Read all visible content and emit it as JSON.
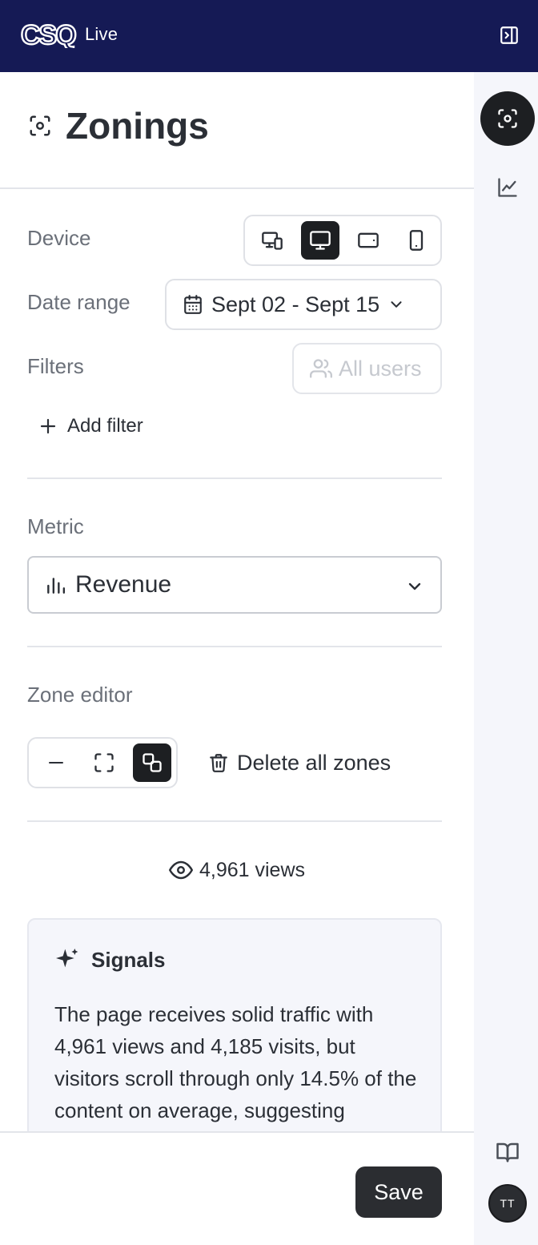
{
  "header": {
    "logo_text": "CSQ",
    "product": "Live"
  },
  "panel": {
    "title": "Zonings",
    "device": {
      "label": "Device",
      "options": [
        "all-devices",
        "desktop",
        "tablet",
        "mobile"
      ],
      "selected": "desktop"
    },
    "date_range": {
      "label": "Date range",
      "value": "Sept 02 - Sept 15"
    },
    "filters": {
      "label": "Filters",
      "segment": "All users",
      "add_label": "Add filter"
    },
    "metric": {
      "label": "Metric",
      "value": "Revenue"
    },
    "zone_editor": {
      "label": "Zone editor",
      "tools": [
        "remove",
        "select-area",
        "link-zones"
      ],
      "active_tool": "link-zones",
      "delete_label": "Delete all zones"
    },
    "views": "4,961 views",
    "signals": {
      "title": "Signals",
      "body": "The page receives solid traffic with 4,961 views and 4,185 visits, but visitors scroll through only 14.5% of the content on average, suggesting"
    }
  },
  "footer": {
    "save_label": "Save"
  },
  "rail": {
    "avatar_initials": "TT"
  },
  "colors": {
    "header_bg": "#151a55",
    "rail_bg": "#f5f6fb",
    "active_dark": "#1d1f22",
    "text": "#2b2f36",
    "muted": "#6b7079"
  }
}
